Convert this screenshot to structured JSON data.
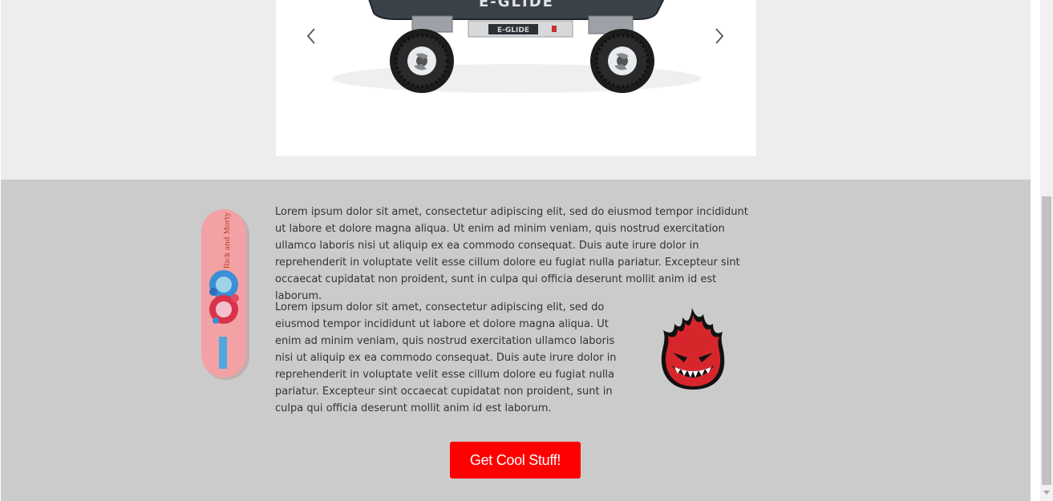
{
  "carousel": {
    "image_text": "E-GLIDE",
    "prev_icon": "chevron-left-icon",
    "next_icon": "chevron-right-icon"
  },
  "content": {
    "paragraph_1": "Lorem ipsum dolor sit amet, consectetur adipiscing elit, sed do eiusmod tempor incididunt ut labore et dolore magna aliqua. Ut enim ad minim veniam, quis nostrud exercitation ullamco laboris nisi ut aliquip ex ea commodo consequat. Duis aute irure dolor in reprehenderit in voluptate velit esse cillum dolore eu fugiat nulla pariatur. Excepteur sint occaecat cupidatat non proident, sunt in culpa qui officia deserunt mollit anim id est laborum.",
    "paragraph_2": "Lorem ipsum dolor sit amet, consectetur adipiscing elit, sed do eiusmod tempor incididunt ut labore et dolore magna aliqua. Ut enim ad minim veniam, quis nostrud exercitation ullamco laboris nisi ut aliquip ex ea commodo consequat. Duis aute irure dolor in reprehenderit in voluptate velit esse cillum dolore eu fugiat nulla pariatur. Excepteur sint occaecat cupidatat non proident, sunt in culpa qui officia deserunt mollit anim id est laborum.",
    "deck_text": "Rick and Morty",
    "cta_label": "Get Cool Stuff!"
  },
  "colors": {
    "top_background": "#ecedef",
    "bottom_background": "#cbcbcb",
    "cta_background": "#ff0000",
    "logo_red": "#d7262b"
  }
}
